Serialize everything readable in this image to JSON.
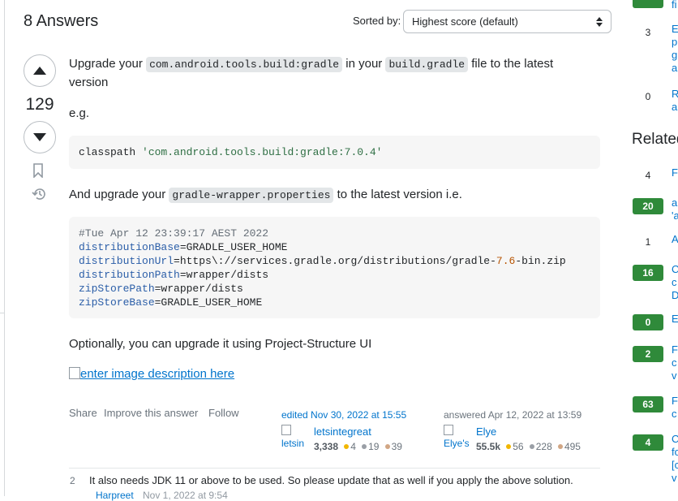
{
  "answers_header": {
    "title": "8 Answers",
    "sort_label": "Sorted by:",
    "sort_value": "Highest score (default)"
  },
  "answer": {
    "score": "129",
    "p1": {
      "t1": "Upgrade your ",
      "c1": "com.android.tools.build:gradle",
      "t2": " in your ",
      "c2": "build.gradle",
      "t3": " file to the latest",
      "t4": "version"
    },
    "eg": "e.g.",
    "code1": {
      "prefix": "classpath ",
      "string": "'com.android.tools.build:gradle:7.0.4'"
    },
    "p2": {
      "t1": "And upgrade your ",
      "c1": "gradle-wrapper.properties",
      "t2": " to the latest version i.e."
    },
    "code2": {
      "comment": "#Tue Apr 12 23:39:17 AEST 2022",
      "l1_key": "distributionBase",
      "l1_val": "=GRADLE_USER_HOME",
      "l2_key": "distributionUrl",
      "l2_val_a": "=https\\://services.gradle.org/distributions/gradle-",
      "l2_num": "7.6",
      "l2_val_b": "-bin.zip",
      "l3_key": "distributionPath",
      "l3_val": "=wrapper/dists",
      "l4_key": "zipStorePath",
      "l4_val": "=wrapper/dists",
      "l5_key": "zipStoreBase",
      "l5_val": "=GRADLE_USER_HOME"
    },
    "p3": "Optionally, you can upgrade it using Project-Structure UI",
    "image_alt": "enter image description here",
    "actions": {
      "share": "Share",
      "improve": "Improve this answer",
      "follow": "Follow"
    },
    "editor": {
      "label": "edited Nov 30, 2022 at 15:55",
      "avatar_alt": "letsin",
      "name": "letsintegreat",
      "rep": "3,338",
      "gold": "4",
      "silver": "19",
      "bronze": "39"
    },
    "author": {
      "label": "answered Apr 12, 2022 at 13:59",
      "avatar_alt": "Elye's",
      "name": "Elye",
      "rep": "55.5k",
      "gold": "56",
      "silver": "228",
      "bronze": "495"
    },
    "comment": {
      "score": "2",
      "text": "It also needs JDK 11 or above to be used. So please update that as well if you apply the above solution.",
      "author": "Harpreet",
      "date": "Nov 1, 2022 at 9:54"
    }
  },
  "sidebar": {
    "linked": [
      {
        "count": "",
        "label": "fi"
      },
      {
        "count": "3",
        "label": "E",
        "l2": "p",
        "l3": "g",
        "l4": "a"
      },
      {
        "count": "0",
        "label": "R",
        "l2": "a"
      }
    ],
    "related_title": "Related",
    "related": [
      {
        "count": "4",
        "label": "F"
      },
      {
        "count": "20",
        "label": "a",
        "l2": "'a"
      },
      {
        "count": "1",
        "label": "A"
      },
      {
        "count": "16",
        "label": "C",
        "l2": "c",
        "l3": "D"
      },
      {
        "count": "0",
        "label": "E"
      },
      {
        "count": "2",
        "label": "F",
        "l2": "c",
        "l3": "v"
      },
      {
        "count": "63",
        "label": "F",
        "l2": "c"
      },
      {
        "count": "4",
        "label": "C",
        "l2": "fo",
        "l3": "[c",
        "l4": "v"
      }
    ]
  },
  "colors": {
    "accent_link": "#0074cc",
    "accepted_green": "#2f8a3a",
    "gold": "#f1b600",
    "silver": "#9a9fa6",
    "bronze": "#d1a684"
  }
}
